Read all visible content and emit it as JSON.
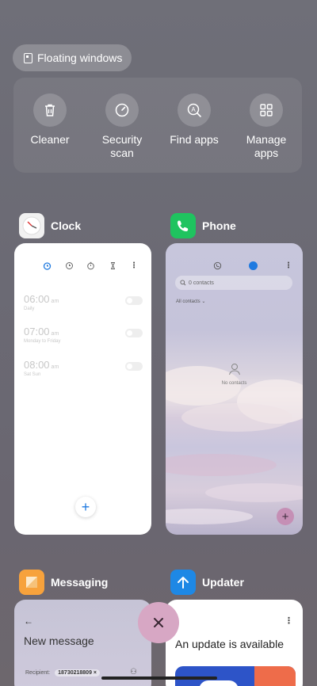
{
  "floating_windows": {
    "label": "Floating windows"
  },
  "tools": [
    {
      "label": "Cleaner",
      "icon": "trash-icon"
    },
    {
      "label": "Security scan",
      "label_line1": "Security",
      "label_line2": "scan",
      "icon": "shield-gauge-icon"
    },
    {
      "label": "Find apps",
      "icon": "find-apps-icon"
    },
    {
      "label": "Manage apps",
      "label_line1": "Manage",
      "label_line2": "apps",
      "icon": "grid-icon"
    }
  ],
  "apps": {
    "clock": {
      "title": "Clock",
      "alarms": [
        {
          "time": "06:00",
          "ampm": "am",
          "repeat": "Daily"
        },
        {
          "time": "07:00",
          "ampm": "am",
          "repeat": "Monday to Friday"
        },
        {
          "time": "08:00",
          "ampm": "am",
          "repeat": "Sat Sun"
        }
      ]
    },
    "phone": {
      "title": "Phone",
      "search_placeholder": "0 contacts",
      "filter": "All contacts",
      "empty_text": "No contacts"
    },
    "messaging": {
      "title": "Messaging",
      "header": "New message",
      "recipient_label": "Recipient:",
      "recipient_value": "18730218809"
    },
    "updater": {
      "title": "Updater",
      "headline": "An update is available"
    }
  },
  "colors": {
    "accent_blue": "#1f7ae0",
    "phone_green": "#1fc35f",
    "messaging_orange": "#f7a23c",
    "updater_blue": "#1e88e5",
    "close_fab": "#d7a7c4"
  }
}
